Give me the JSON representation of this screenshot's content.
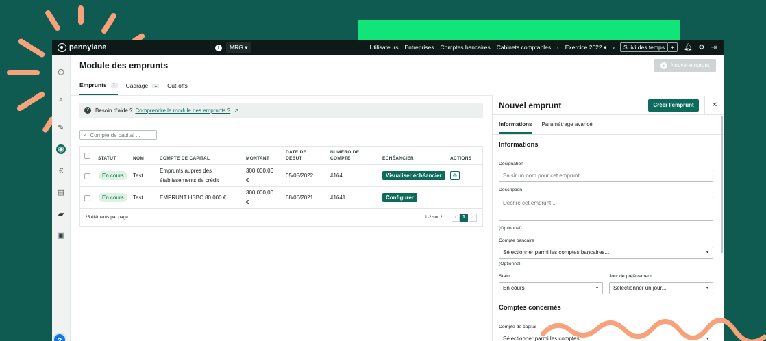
{
  "brand": {
    "name": "pennylane",
    "accent": "#0d6b5c",
    "topbar_bg": "#0d1a18",
    "background": "#0f5b51"
  },
  "topbar": {
    "company": "MRG",
    "nav": [
      "Utilisateurs",
      "Entreprises",
      "Comptes bancaires",
      "Cabinets comptables"
    ],
    "exercise": "Exercice 2022",
    "time_tracking": "Suivi des temps",
    "plus": "+",
    "icons": [
      "info-icon",
      "chevron-left-icon",
      "chevron-right-icon",
      "bell-icon",
      "gear-icon",
      "logout-icon"
    ]
  },
  "page": {
    "title": "Module des emprunts",
    "new_button": "Nouvel emprunt",
    "tabs": [
      {
        "label": "Emprunts",
        "count": "1"
      },
      {
        "label": "Cadrage",
        "count": "1"
      },
      {
        "label": "Cut-offs"
      }
    ],
    "help": {
      "text": "Besoin d'aide ?",
      "link": "Comprendre le module des emprunts ?"
    },
    "search_placeholder": "Compte de capital ..."
  },
  "table": {
    "headers": {
      "statut": "STATUT",
      "nom": "NOM",
      "compte": "COMPTE DE CAPITAL",
      "montant": "MONTANT",
      "date_l1": "DATE DE",
      "date_l2": "DÉBUT",
      "num_l1": "NUMÉRO DE",
      "num_l2": "COMPTE",
      "echeancier": "ÉCHÉANCIER",
      "actions": "ACTIONS"
    },
    "rows": [
      {
        "statut": "En cours",
        "nom": "Test",
        "compte_l1": "Emprunts auprès des",
        "compte_l2": "établissements de crédit",
        "montant_l1": "300 000,00",
        "montant_l2": "€",
        "date": "05/05/2022",
        "numero": "#164",
        "echeancier": "Visualiser échéancier"
      },
      {
        "statut": "En cours",
        "nom": "Test",
        "compte_l1": "EMPRUNT HSBC 80 000 €",
        "compte_l2": "",
        "montant_l1": "300 000,00",
        "montant_l2": "€",
        "date": "08/06/2021",
        "numero": "#1641",
        "echeancier": "Configurer"
      }
    ],
    "per_page": "25 éléments par page",
    "range": "1-2 sur 2",
    "prev": "‹",
    "current_page": "1",
    "next": "›"
  },
  "panel": {
    "title": "Nouvel emprunt",
    "create_button": "Créer l'emprunt",
    "close": "✕",
    "tabs": [
      "Informations",
      "Paramétrage avancé"
    ],
    "section_info": "Informations",
    "designation_label": "Désignation",
    "designation_placeholder": "Saisir un nom pour cet emprunt...",
    "description_label": "Description",
    "description_placeholder": "Décrire cet emprunt...",
    "optional": "(Optionnel)",
    "bank_label": "Compte bancaire",
    "bank_placeholder": "Sélectionner parmi les comptes bancaires...",
    "status_label": "Statut",
    "status_value": "En cours",
    "day_label": "Jour de prélèvement",
    "day_placeholder": "Sélectionner un jour...",
    "section_accounts": "Comptes concernés",
    "capital_label": "Compte de capital",
    "capital_placeholder": "Sélectionner parmi les comptes..."
  }
}
